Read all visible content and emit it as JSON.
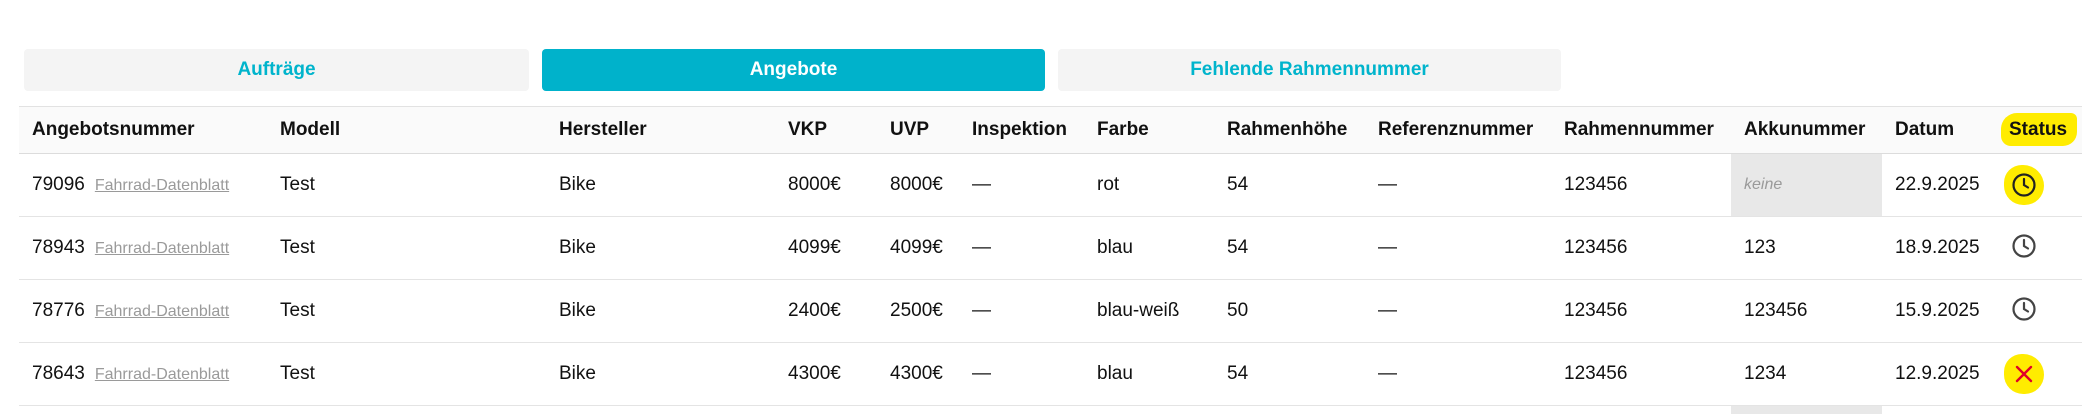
{
  "tabs": [
    {
      "label": "Aufträge",
      "active": false
    },
    {
      "label": "Angebote",
      "active": true
    },
    {
      "label": "Fehlende Rahmennummer",
      "active": false
    }
  ],
  "columns": [
    "Angebotsnummer",
    "Modell",
    "Hersteller",
    "VKP",
    "UVP",
    "Inspektion",
    "Farbe",
    "Rahmenhöhe",
    "Referenznummer",
    "Rahmennummer",
    "Akkunummer",
    "Datum",
    "Status"
  ],
  "rows": [
    {
      "nr": "79096",
      "link": "Fahrrad-Datenblatt",
      "modell": "Test",
      "hersteller": "Bike",
      "vkp": "8000€",
      "uvp": "8000€",
      "inspektion": "—",
      "farbe": "rot",
      "rahmenhoehe": "54",
      "referenz": "—",
      "rahmennummer": "123456",
      "akku": "keine",
      "datum": "22.9.2025",
      "status": "pending-clock-icon"
    },
    {
      "nr": "78943",
      "link": "Fahrrad-Datenblatt",
      "modell": "Test",
      "hersteller": "Bike",
      "vkp": "4099€",
      "uvp": "4099€",
      "inspektion": "—",
      "farbe": "blau",
      "rahmenhoehe": "54",
      "referenz": "—",
      "rahmennummer": "123456",
      "akku": "123",
      "datum": "18.9.2025",
      "status": "pending-clock-icon"
    },
    {
      "nr": "78776",
      "link": "Fahrrad-Datenblatt",
      "modell": "Test",
      "hersteller": "Bike",
      "vkp": "2400€",
      "uvp": "2500€",
      "inspektion": "—",
      "farbe": "blau-weiß",
      "rahmenhoehe": "50",
      "referenz": "—",
      "rahmennummer": "123456",
      "akku": "123456",
      "datum": "15.9.2025",
      "status": "pending-clock-icon"
    },
    {
      "nr": "78643",
      "link": "Fahrrad-Datenblatt",
      "modell": "Test",
      "hersteller": "Bike",
      "vkp": "4300€",
      "uvp": "4300€",
      "inspektion": "—",
      "farbe": "blau",
      "rahmenhoehe": "54",
      "referenz": "—",
      "rahmennummer": "123456",
      "akku": "1234",
      "datum": "12.9.2025",
      "status": "rejected-x-icon"
    }
  ],
  "colors": {
    "accent": "#00b2cb",
    "highlight": "#ffec00",
    "reject": "#e0002a"
  }
}
